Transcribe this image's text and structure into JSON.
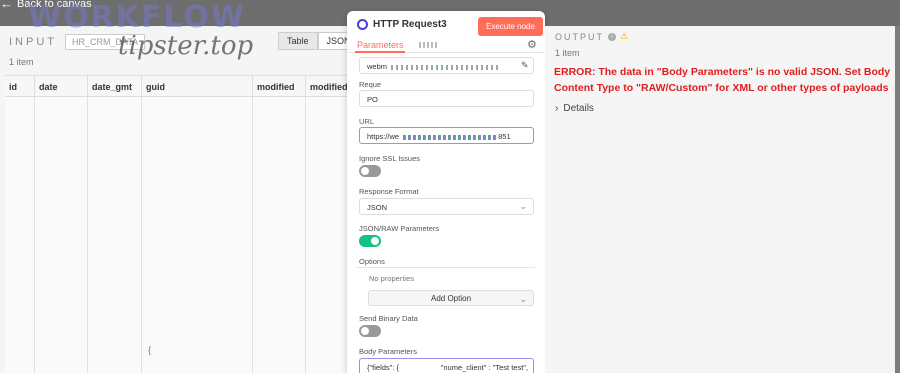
{
  "topbar": {
    "back_label": "Back to canvas"
  },
  "input": {
    "title": "INPUT",
    "select_value": "HR_CRM_DATA",
    "view_toggle": [
      "Table",
      "JSON"
    ],
    "active_view": "Table",
    "item_count": "1 item",
    "columns": [
      "id",
      "date",
      "date_gmt",
      "guid",
      "modified",
      "modified"
    ],
    "trailing_text": "{"
  },
  "watermark": {
    "line1": "WORKFLOW",
    "line2": "tipster.top"
  },
  "node": {
    "title": "HTTP Request3",
    "execute_label": "Execute node",
    "tab_label": "Parameters",
    "auth_value": "webm",
    "request_method_label": "Reque",
    "request_method_value": "PO",
    "url_label": "URL",
    "url_prefix": "https://we",
    "url_suffix": "851",
    "ignore_ssl_label": "Ignore SSL Issues",
    "ignore_ssl": false,
    "response_format_label": "Response Format",
    "response_format_value": "JSON",
    "json_raw_label": "JSON/RAW Parameters",
    "json_raw": true,
    "options_label": "Options",
    "no_properties": "No properties",
    "add_option_label": "Add Option",
    "send_binary_label": "Send Binary Data",
    "send_binary": false,
    "body_params_label": "Body Parameters",
    "body_params_value": "{\"fields\": {                    \"nume_client\" : \"Test test\","
  },
  "output": {
    "title": "OUTPUT",
    "item_count": "1 item",
    "error": "ERROR: The data in \"Body Parameters\" is no valid JSON. Set Body Content Type to \"RAW/Custom\" for XML or other types of payloads",
    "details_label": "Details"
  },
  "colors": {
    "accent": "#ff6d5a",
    "error": "#e01e1e",
    "toggle_on": "#13c27e",
    "icon": "#4a3fd6"
  }
}
